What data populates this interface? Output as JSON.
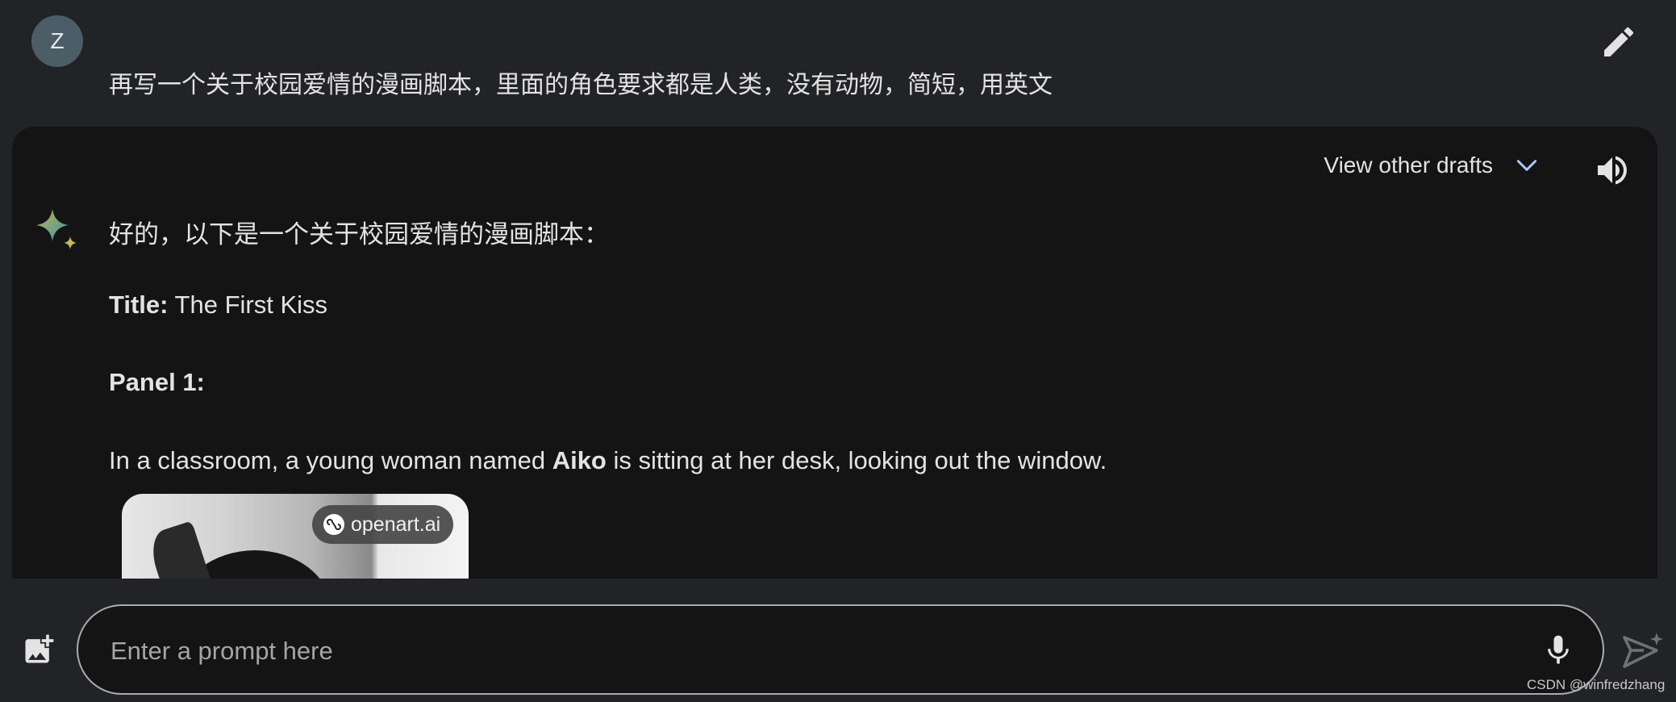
{
  "user": {
    "avatar_initial": "Z",
    "query": "再写一个关于校园爱情的漫画脚本，里面的角色要求都是人类，没有动物，简短，用英文"
  },
  "response": {
    "view_drafts_label": "View other drafts",
    "intro": "好的，以下是一个关于校园爱情的漫画脚本：",
    "title_label": "Title:",
    "title_value": " The First Kiss",
    "panel_label": "Panel 1:",
    "line_before": "In a classroom, a young woman named ",
    "line_bold": "Aiko",
    "line_after": " is sitting at her desk, looking out the window.",
    "image_badge": "openart.ai"
  },
  "input": {
    "placeholder": "Enter a prompt here"
  },
  "watermark": "CSDN @winfredzhang",
  "icons": {
    "edit": "pencil-icon",
    "drafts_toggle": "chevron-down-icon",
    "speaker": "volume-icon",
    "assistant": "sparkle-icon",
    "add_image": "add-image-icon",
    "mic": "microphone-icon",
    "send": "send-icon"
  },
  "colors": {
    "background": "#222326",
    "card": "#141415",
    "text": "#e3e3e3",
    "chevron": "#a8c7fa"
  }
}
